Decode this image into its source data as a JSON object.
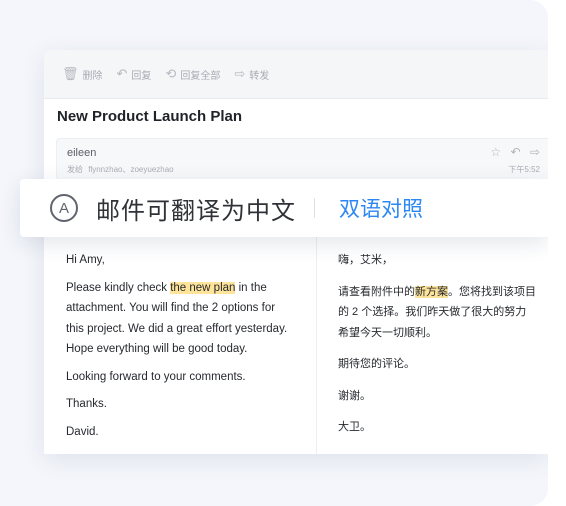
{
  "toolbar": {
    "items": [
      {
        "icon": "trash-icon",
        "label": "删除"
      },
      {
        "icon": "reply-icon",
        "label": "回复"
      },
      {
        "icon": "reply-all-icon",
        "label": "回复全部"
      },
      {
        "icon": "forward-icon",
        "label": "转发"
      }
    ]
  },
  "email": {
    "subject": "New Product Launch Plan",
    "sender": "eileen",
    "recipients_label": "发给",
    "recipients": "flynnzhao、zoeyuezhao",
    "time": "下午5:52"
  },
  "translate_bar": {
    "label": "邮件可翻译为中文",
    "action": "双语对照",
    "icon_letter": "A"
  },
  "original": {
    "greeting": "Hi Amy,",
    "p1_before": "Please kindly check ",
    "p1_highlight": "the new plan",
    "p1_after": " in the attachment. You will find the 2 options for this project.  We did a great effort yesterday. Hope everything will be good today.",
    "p2": "Looking forward to your comments.",
    "p3": "Thanks.",
    "signature": "David."
  },
  "translation": {
    "greeting": "嗨，艾米，",
    "p1_before": "请查看附件中的",
    "p1_highlight": "新方案",
    "p1_after": "。您将找到该项目",
    "p1_line2": "的 2 个选择。我们昨天做了很大的努力",
    "p1_line3": "希望今天一切顺利。",
    "p2": "期待您的评论。",
    "p3": "谢谢。",
    "signature": "大卫。"
  }
}
